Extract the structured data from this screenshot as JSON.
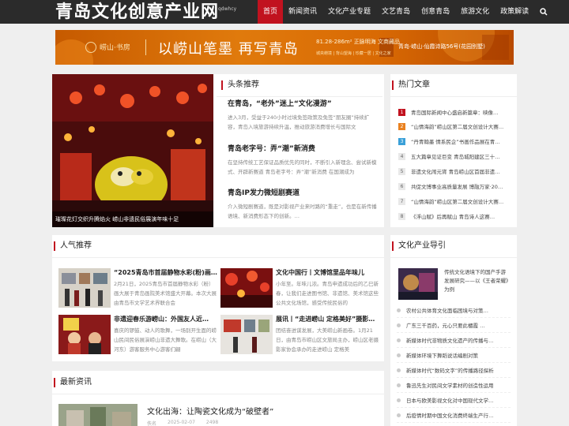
{
  "header": {
    "logo_text": "青岛文化创意产业网",
    "logo_sub": "qdwhcy",
    "nav": [
      "首页",
      "新闻资讯",
      "文化产业专题",
      "文艺青岛",
      "创意青岛",
      "旅游文化",
      "政策解读"
    ],
    "search_icon": "search-icon"
  },
  "banner": {
    "brand": "崂山·书房",
    "slogan": "以崂山笔墨  再写青岛",
    "info": "81.28-286m² 正脉明海  文商藏品",
    "info2": "城央崂境 | 背山望海 | 珍藏一居 | 文化之家",
    "right": "青岛·崂山·仙霞诗路56号(花园别墅)"
  },
  "hero": {
    "caption": "璀璨花灯交织升腾焰火 崂山非遗民俗展演年味十足"
  },
  "headlines": {
    "title": "头条推荐",
    "items": [
      {
        "title": "在青岛，“老外”迷上“文化漫游”",
        "text": "进入3月，受益于240小时过境免签政策及免签“朋友圈”持续扩容，青岛入境旅游持续升温，推动旅游消费增长与国际文"
      },
      {
        "title": "青岛老字号：弄“潮”新消费",
        "text": "在坚持传统工艺保证品质优先的同时，不断引入新理念、尝试新模式、开辟新赛道 青岛老字号：弄“潮”新消费 在国潮成为"
      },
      {
        "title": "青岛IP发力微短剧赛道",
        "text": "介入微短剧赛道，既是对影视产业来时路的“重走”，也是在新传播语境、新消费形态下的创新。…"
      }
    ]
  },
  "hot": {
    "title": "热门文章",
    "items": [
      "青岛国际新闻中心盛启新篇章：映像…",
      "“山情海韵”崂山区第二届文创设计大赛…",
      "“丹青翰墨 情系民企”书画作品展在青…",
      "五大篇章见证巨变 青岛城阳建区三十…",
      "非遗文化闹元宵 青岛崂山区首届非遗…",
      "共促文博事业高质量发展 博融万家·20…",
      "“山情海韵”崂山区第二届文创设计大赛…",
      "《浮山赋》后再赋山 青岛诗人这赛…"
    ]
  },
  "popular": {
    "title": "人气推荐",
    "items": [
      {
        "title": "“2025青岛市首届静物水彩(粉)画…",
        "text": "2月21日，2025青岛市首届静物水彩（粉）画大展于青岛画院美术馆盛大开幕。本次大展由青岛市文学艺术界联合会"
      },
      {
        "title": "文化中国行丨文博馆里品年味儿",
        "text": "小年至。年味儿浓。青岛申遗成功后的乙巳新春，让我们走进图书馆、非遗馆、美术馆这些公共文化场馆，感受传统民俗的"
      },
      {
        "title": "非遗迎春乐游崂山：外国友人近…",
        "text": "喜庆的锣鼓、动人的歌舞，一场别开生面的崂山民间民俗展演崂山非遗大舞歌。在崂山（大河东）游客服务中心游客们翩"
      },
      {
        "title": "展讯丨“走进崂山 定格美好”摄影…",
        "text": "团结奋进谋发展，大美崂山新画卷。1月21日，由青岛市崂山区文旅局主办，崂山区老摄影家协会承办的走进崂山 定格美"
      }
    ]
  },
  "industry": {
    "title": "文化产业导引",
    "feature": "传统文化语境下的国产手游发展研究——以《王者荣耀》为例",
    "items": [
      "农村公共体育文化面临困境与对策…",
      "广东三千百药，元心只要此楣霞 …",
      "新媒体时代非物质文化遗产的传播与…",
      "新媒体环境下舞蹈说话编剧对策",
      "新媒体时代“数码文字”的传播路径探析",
      "鲁迅先生对民间文学素材的创造性运用",
      "日本与欧美影视文化对中国现代文学…",
      "后疫情时期中国文化消费终端生产行…"
    ]
  },
  "latest": {
    "title": "最新资讯",
    "item_title": "文化出海：让陶瓷文化成为“破壁者”",
    "author": "佚名",
    "date": "2025-02-07",
    "views": "2498"
  }
}
